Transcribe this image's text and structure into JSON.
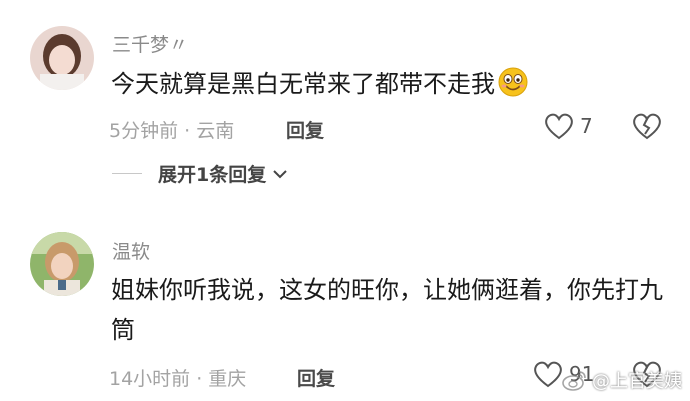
{
  "comments": [
    {
      "author": "三千梦〃",
      "text": "今天就算是黑白无常来了都带不走我",
      "emoji": "smile-emoji",
      "time_location": "5分钟前 · 云南",
      "reply_label": "回复",
      "likes": "7",
      "expand_replies": "展开1条回复"
    },
    {
      "author": "温软",
      "text": "姐妹你听我说，这女的旺你，让她俩逛着，你先打九筒",
      "time_location": "14小时前 · 重庆",
      "reply_label": "回复",
      "likes": "91"
    }
  ],
  "watermark": "@上官美姨",
  "icons": [
    "heart-icon",
    "broken-heart-icon",
    "chevron-down-icon",
    "weibo-icon"
  ],
  "colors": {
    "text": "#1a1a1a",
    "meta": "#a3a3a3",
    "emoji": "#f7c21c"
  }
}
